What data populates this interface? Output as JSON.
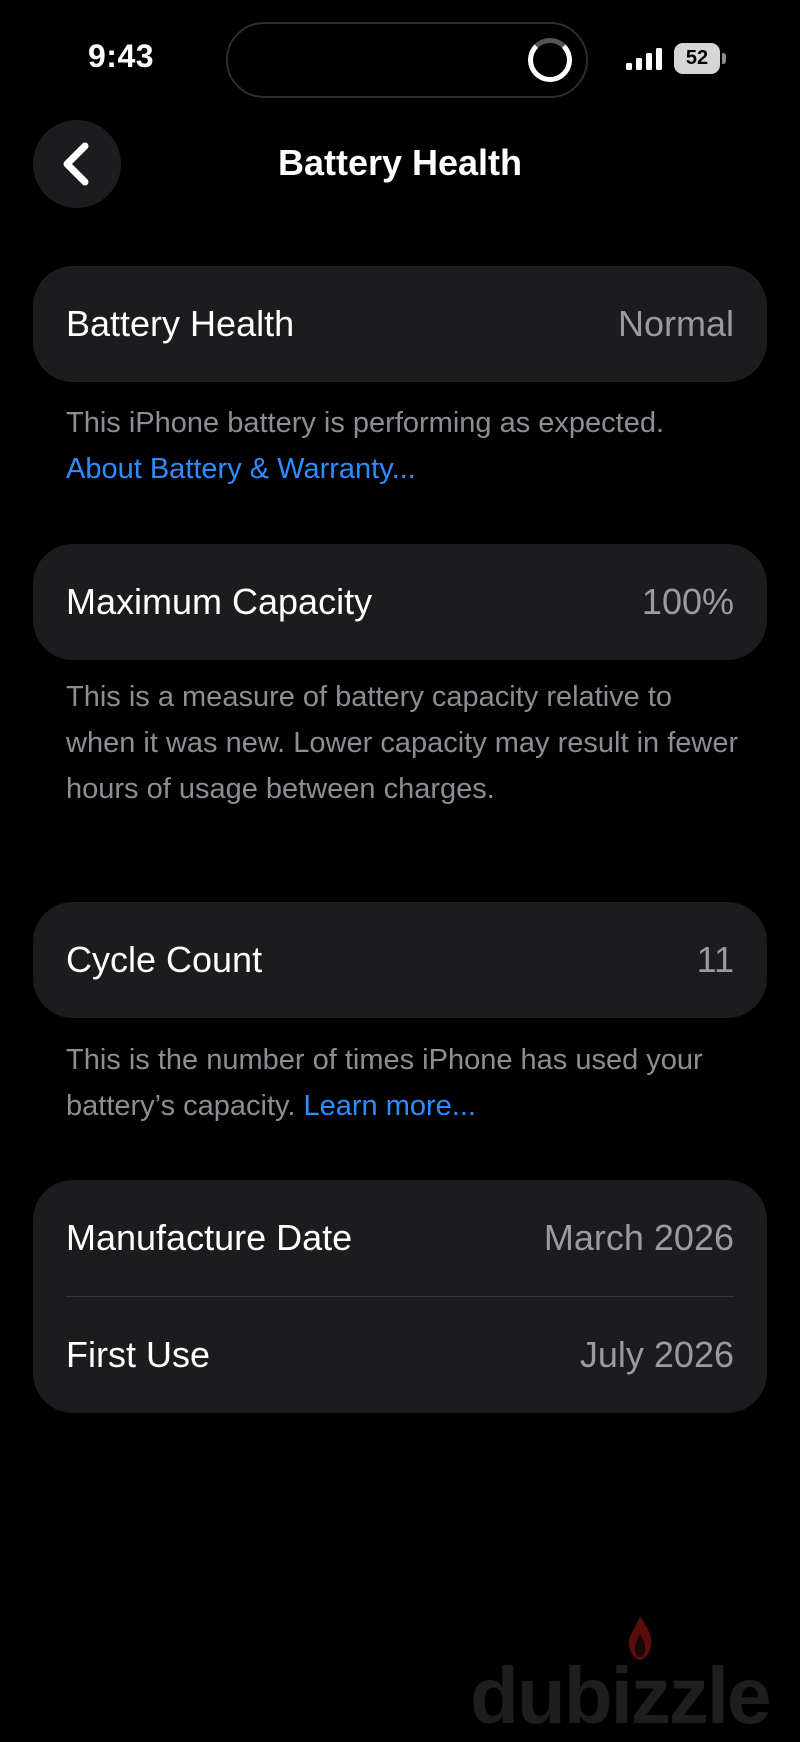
{
  "status_bar": {
    "time": "9:43",
    "battery_level": "52",
    "icons": [
      "loading-spinner-icon",
      "signal-icon",
      "battery-icon"
    ]
  },
  "nav": {
    "back_icon": "chevron-left-icon",
    "title": "Battery Health"
  },
  "battery_health": {
    "label": "Battery Health",
    "value": "Normal",
    "description": "This iPhone battery is performing as expected.",
    "link": "About Battery & Warranty..."
  },
  "maximum_capacity": {
    "label": "Maximum Capacity",
    "value": "100%",
    "description": "This is a measure of battery capacity relative to when it was new. Lower capacity may result in fewer hours of usage between charges."
  },
  "cycle_count": {
    "label": "Cycle Count",
    "value": "11",
    "description": "This is the number of times iPhone has used your battery’s capacity.",
    "link": "Learn more..."
  },
  "dates": {
    "manufacture_label": "Manufacture Date",
    "manufacture_value": "March 2026",
    "first_use_label": "First Use",
    "first_use_value": "July 2026"
  },
  "watermark": {
    "text": "dubizzle"
  },
  "colors": {
    "background": "#000000",
    "card": "#1c1c1e",
    "link": "#2f8cff",
    "secondary_text": "#8d8d93"
  }
}
